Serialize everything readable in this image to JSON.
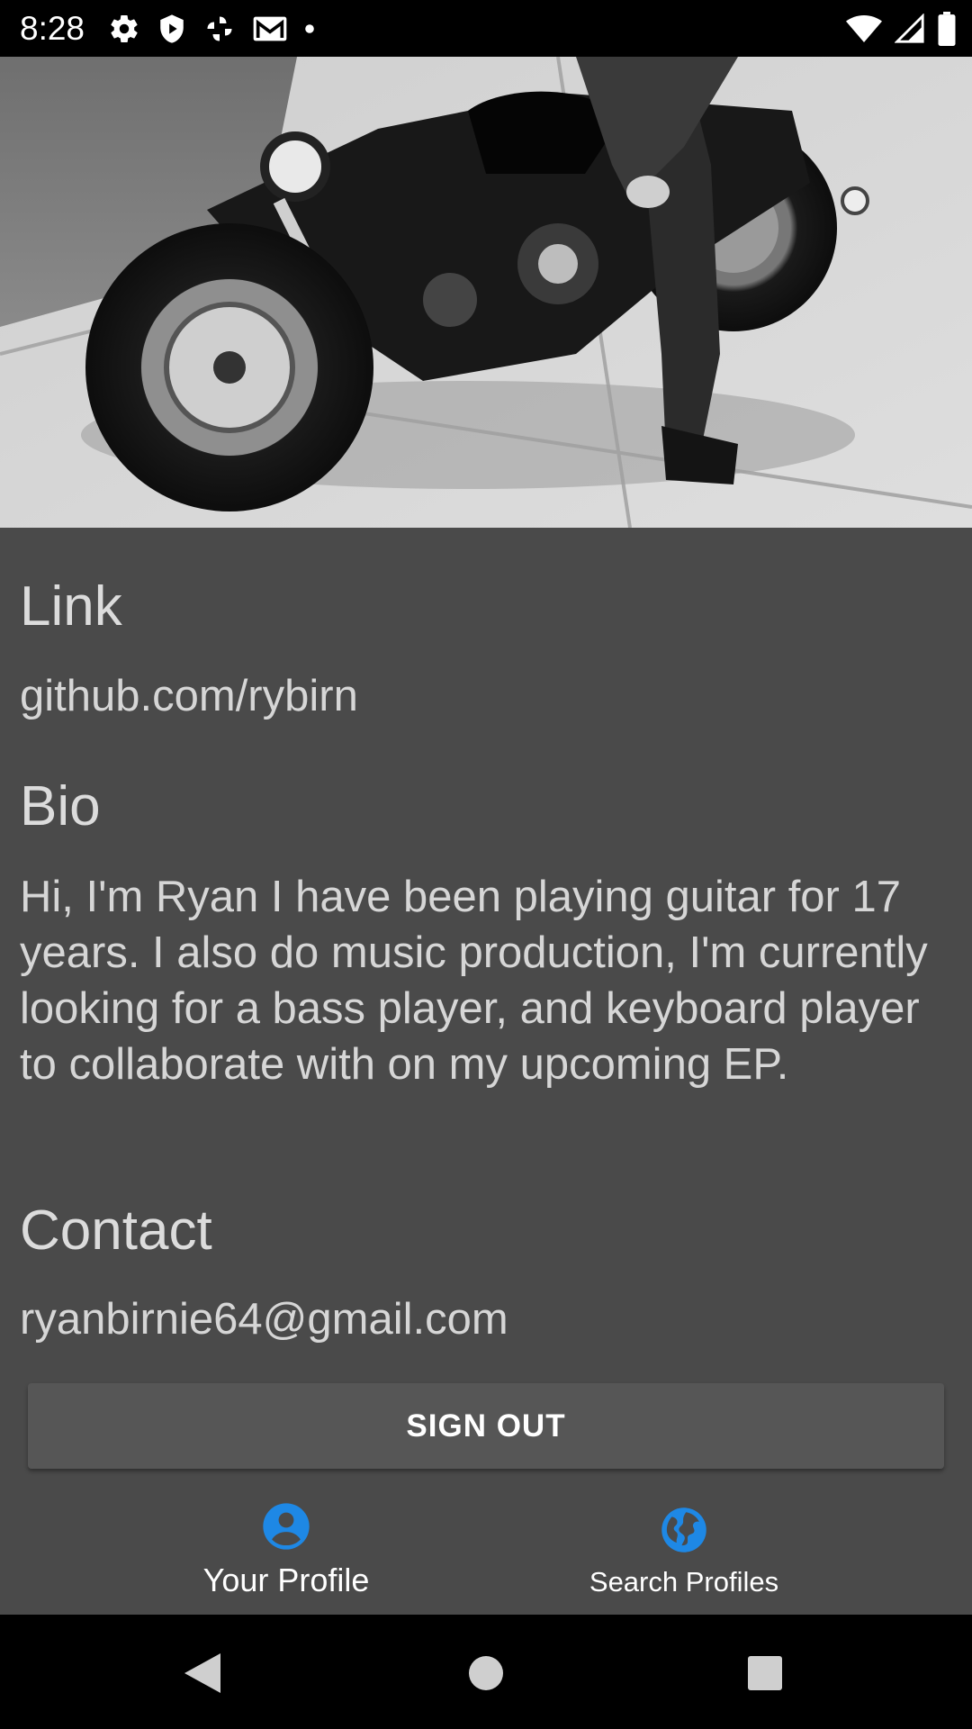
{
  "status_bar": {
    "time": "8:28",
    "left_icons": [
      "gear-icon",
      "shield-play-icon",
      "pinwheel-icon",
      "gmail-icon",
      "dot-icon"
    ],
    "right_icons": [
      "wifi-icon",
      "cell-signal-icon",
      "battery-icon"
    ]
  },
  "header": {
    "image": "motorcycle-photo",
    "image_description_icon": "photo-icon"
  },
  "profile": {
    "link_heading": "Link",
    "link_value": "github.com/rybirn",
    "bio_heading": "Bio",
    "bio_value": "Hi, I'm Ryan I have been playing guitar for 17 years. I also do music production, I'm currently looking for a bass player, and keyboard player to collaborate with on my upcoming EP.",
    "contact_heading": "Contact",
    "contact_value": "ryanbirnie64@gmail.com"
  },
  "actions": {
    "sign_out_label": "SIGN OUT"
  },
  "bottom_nav": {
    "items": [
      {
        "label": "Your Profile",
        "icon": "account-circle-icon",
        "active": true
      },
      {
        "label": "Search Profiles",
        "icon": "globe-icon",
        "active": false
      }
    ]
  },
  "system_nav": {
    "buttons": [
      "back-icon",
      "home-icon",
      "recents-icon"
    ]
  },
  "colors": {
    "background": "#4a4a4a",
    "accent": "#1e88e5",
    "button": "#565656",
    "status_bar": "#000000"
  }
}
